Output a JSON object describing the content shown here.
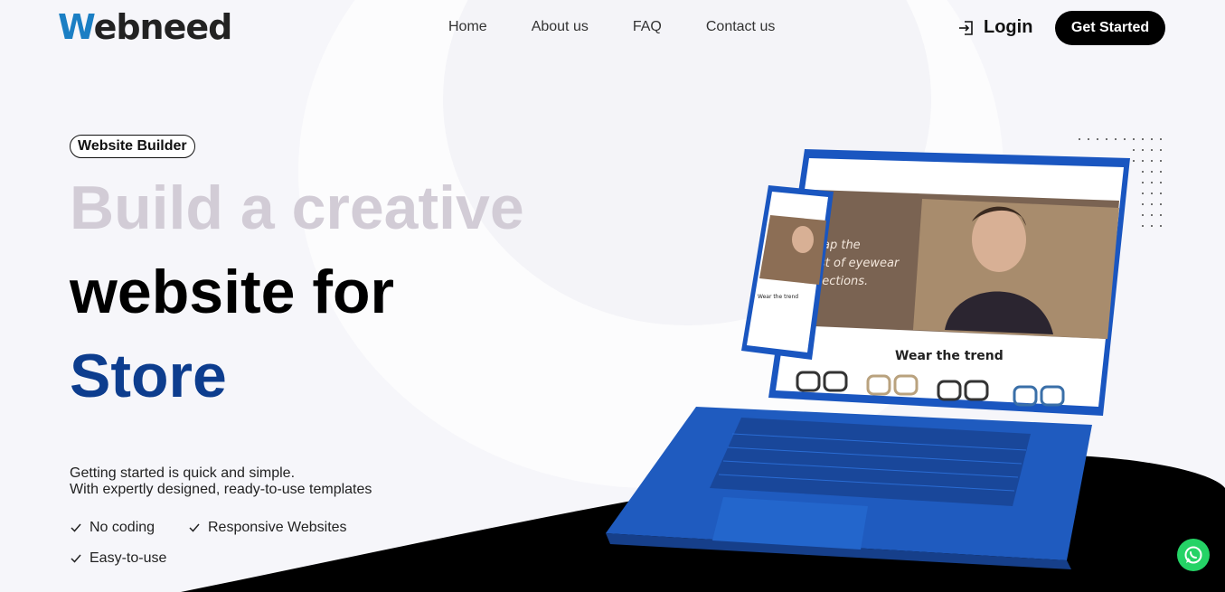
{
  "brand": {
    "logo_first": "W",
    "logo_rest": "ebneed"
  },
  "nav": [
    {
      "label": "Home"
    },
    {
      "label": "About us"
    },
    {
      "label": "FAQ"
    },
    {
      "label": "Contact us"
    }
  ],
  "header": {
    "login_label": "Login",
    "cta_label": "Get Started"
  },
  "hero": {
    "badge": "Website Builder",
    "line1": "Build a creative",
    "line2": "website for",
    "line3": "Store",
    "desc1": "Getting started is quick and simple.",
    "desc2": "With expertly designed, ready-to-use templates",
    "features": [
      "No coding",
      "Responsive Websites",
      "Easy-to-use"
    ]
  },
  "mockup": {
    "hero_text": [
      "ap the",
      "st of eyewear",
      "llections."
    ],
    "section_title": "Wear the trend",
    "phone_section": "Wear the trend"
  },
  "colors": {
    "accent_blue": "#0d3d8e",
    "logo_blue": "#1b7fc4",
    "laptop_blue": "#1f5bbf",
    "whatsapp": "#25d366"
  }
}
